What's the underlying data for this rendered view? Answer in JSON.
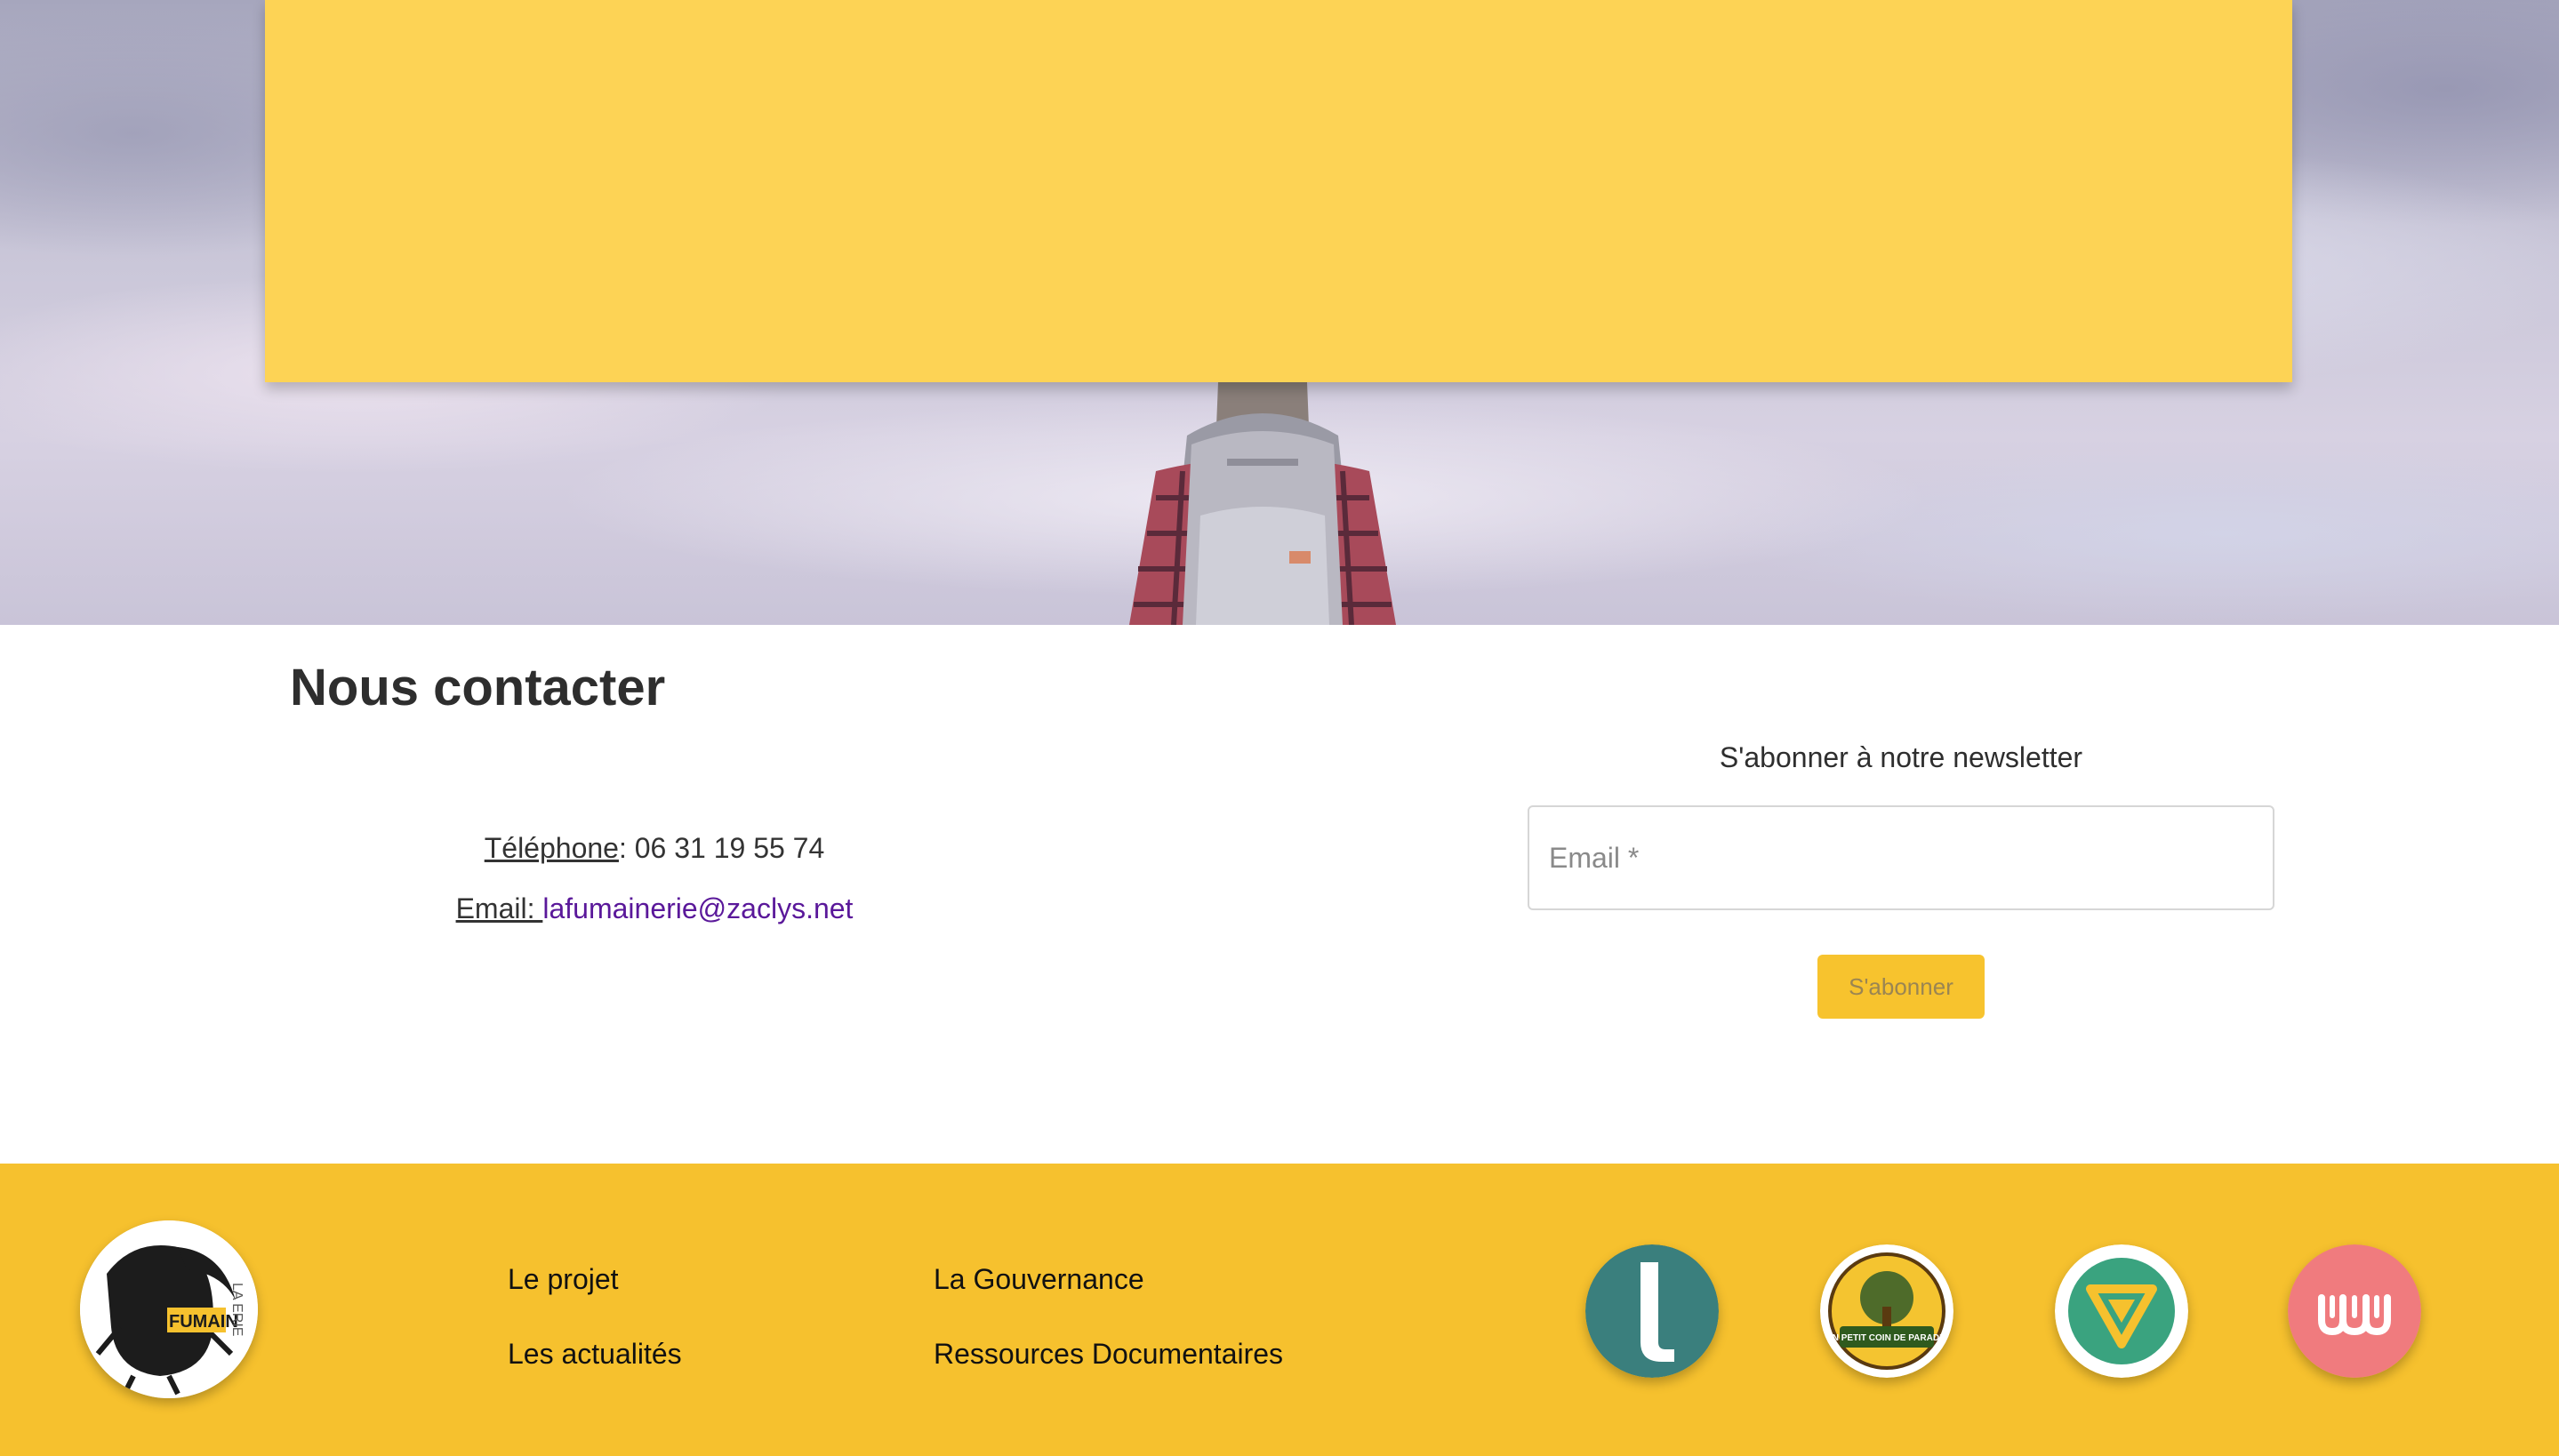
{
  "contact": {
    "title": "Nous contacter",
    "phone_label": "Téléphone",
    "phone_value": ": 06 31 19 55 74",
    "email_label": "Email: ",
    "email_value": "lafumainerie@zaclys.net"
  },
  "newsletter": {
    "title": "S'abonner à notre newsletter",
    "email_placeholder": "Email *",
    "subscribe_label": "S'abonner"
  },
  "footer": {
    "logo_text": "FUMAIN",
    "logo_side_text": "LA ERIE",
    "links": [
      "Le projet",
      "La Gouvernance",
      "Les actualités",
      "Ressources Documentaires"
    ],
    "partner_badge_text": "UN PETIT COIN DE PARADIS"
  },
  "colors": {
    "hero_card": "#fdd355",
    "footer_bg": "#f6c12e",
    "button_bg": "#f7c32e",
    "email_link": "#5a189a",
    "partner_teal": "#3a7f7d",
    "partner_green": "#3aa37f",
    "partner_pink": "#f07b7e"
  }
}
